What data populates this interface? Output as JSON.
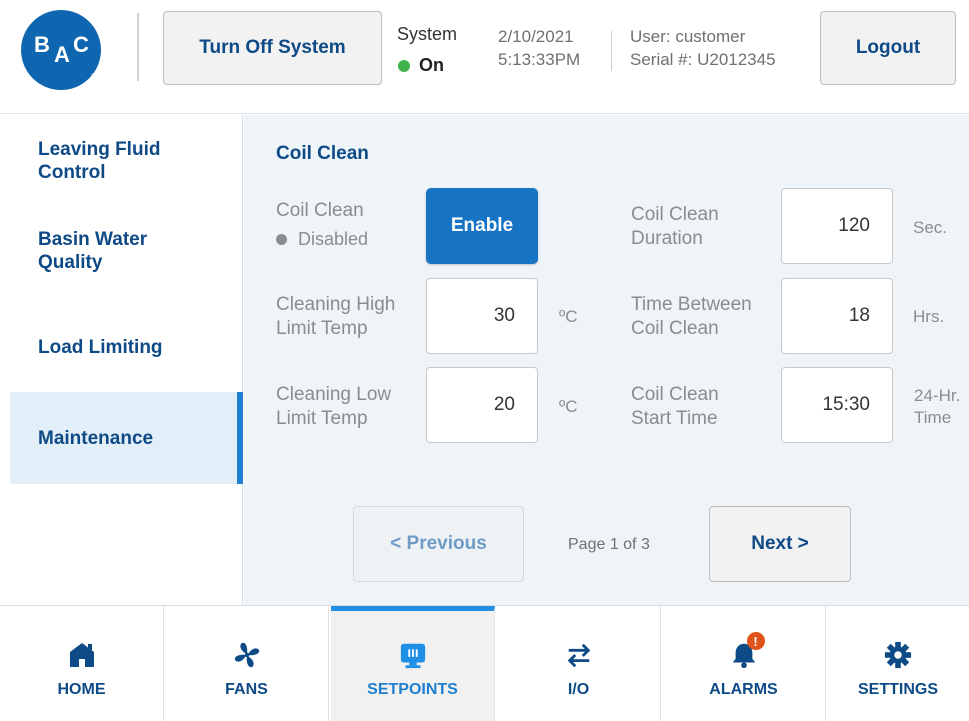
{
  "colors": {
    "brand": "#0f66b0",
    "accent": "#1f7fd0",
    "navy": "#0d4a86",
    "status_on": "#3fb24a",
    "alert": "#e0531b"
  },
  "header": {
    "logo": {
      "b": "B",
      "a": "A",
      "c": "C",
      "reg": "®"
    },
    "turn_off_label": "Turn Off System",
    "system_label": "System",
    "system_status": "On",
    "date": "2/10/2021",
    "time": "5:13:33PM",
    "user": "User: customer",
    "serial": "Serial #: U2012345",
    "logout_label": "Logout"
  },
  "sidebar": {
    "items": [
      {
        "label": "Leaving Fluid Control"
      },
      {
        "label": "Basin Water Quality"
      },
      {
        "label": "Load Limiting"
      },
      {
        "label": "Maintenance",
        "active": true
      }
    ]
  },
  "main": {
    "title": "Coil Clean",
    "coil_clean": {
      "label": "Coil Clean",
      "status": "Disabled",
      "button": "Enable"
    },
    "high_limit": {
      "label_1": "Cleaning High",
      "label_2": "Limit Temp",
      "value": "30",
      "unit": "ºC"
    },
    "low_limit": {
      "label_1": "Cleaning Low",
      "label_2": "Limit Temp",
      "value": "20",
      "unit": "ºC"
    },
    "duration": {
      "label_1": "Coil Clean",
      "label_2": "Duration",
      "value": "120",
      "unit": "Sec."
    },
    "between": {
      "label_1": "Time Between",
      "label_2": "Coil Clean",
      "value": "18",
      "unit": "Hrs."
    },
    "start": {
      "label_1": "Coil Clean",
      "label_2": "Start Time",
      "value": "15:30",
      "unit_1": "24-Hr.",
      "unit_2": "Time"
    },
    "pagination": {
      "previous": "< Previous",
      "page": "Page 1 of 3",
      "next": "Next >"
    }
  },
  "nav": {
    "items": [
      {
        "label": "HOME",
        "icon": "home-icon"
      },
      {
        "label": "FANS",
        "icon": "fan-icon"
      },
      {
        "label": "SETPOINTS",
        "icon": "setpoints-icon",
        "active": true
      },
      {
        "label": "I/O",
        "icon": "io-arrows-icon"
      },
      {
        "label": "ALARMS",
        "icon": "bell-icon",
        "badge": "!"
      },
      {
        "label": "SETTINGS",
        "icon": "gear-icon"
      }
    ]
  }
}
